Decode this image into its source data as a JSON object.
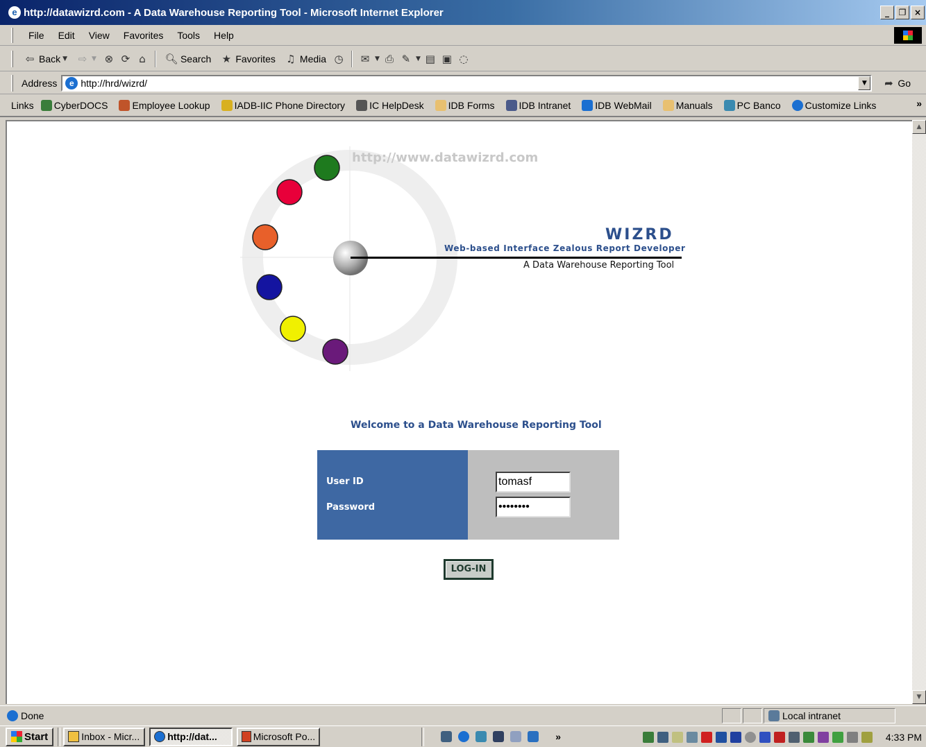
{
  "window": {
    "title": "http://datawizrd.com - A Data Warehouse Reporting Tool - Microsoft Internet Explorer",
    "minimize": "_",
    "maximize": "&#x1F5D7;",
    "close": "×"
  },
  "menu": [
    "File",
    "Edit",
    "View",
    "Favorites",
    "Tools",
    "Help"
  ],
  "toolbar": {
    "back": "Back",
    "search": "Search",
    "favorites": "Favorites",
    "media": "Media"
  },
  "address": {
    "label": "Address",
    "url": "http://hrd/wizrd/",
    "go": "Go"
  },
  "links": {
    "label": "Links",
    "items": [
      {
        "label": "CyberDOCS",
        "icon": "document-icon",
        "color": "#3a7d3a"
      },
      {
        "label": "Employee Lookup",
        "icon": "people-icon",
        "color": "#c0542a"
      },
      {
        "label": "IADB-IIC Phone Directory",
        "icon": "phone-icon",
        "color": "#d8b020"
      },
      {
        "label": "IC HelpDesk",
        "icon": "helpdesk-icon",
        "color": "#555555"
      },
      {
        "label": "IDB Forms",
        "icon": "forms-icon",
        "color": "#e8c070"
      },
      {
        "label": "IDB Intranet",
        "icon": "intranet-icon",
        "color": "#4a5a8a"
      },
      {
        "label": "IDB WebMail",
        "icon": "webmail-icon",
        "color": "#1b6fd1"
      },
      {
        "label": "Manuals",
        "icon": "manuals-icon",
        "color": "#e8c070"
      },
      {
        "label": "PC Banco",
        "icon": "bank-icon",
        "color": "#3a8ab0"
      },
      {
        "label": "Customize Links",
        "icon": "ie-icon",
        "color": "#1b6fd1"
      }
    ],
    "more": "»"
  },
  "page": {
    "site_url": "http://www.datawizrd.com",
    "brand": "WIZRD",
    "brand_subtitle": "Web-based Interface Zealous Report Developer",
    "tagline": "A Data Warehouse Reporting Tool",
    "welcome": "Welcome to a Data Warehouse Reporting Tool",
    "login": {
      "user_label": "User ID",
      "password_label": "Password",
      "user_value": "tomasf",
      "password_value": "********",
      "button": "LOG-IN"
    },
    "logo_colors": [
      "#1e7a1e",
      "#e8003a",
      "#e8602a",
      "#1414a0",
      "#f0f000",
      "#6a1a7a"
    ]
  },
  "status": {
    "text": "Done",
    "zone": "Local intranet"
  },
  "taskbar": {
    "start": "Start",
    "tasks": [
      {
        "label": "Inbox - Micr...",
        "active": false
      },
      {
        "label": "http://dat...",
        "active": true
      },
      {
        "label": "Microsoft Po...",
        "active": false
      }
    ],
    "more": "»",
    "clock": "4:33 PM"
  }
}
